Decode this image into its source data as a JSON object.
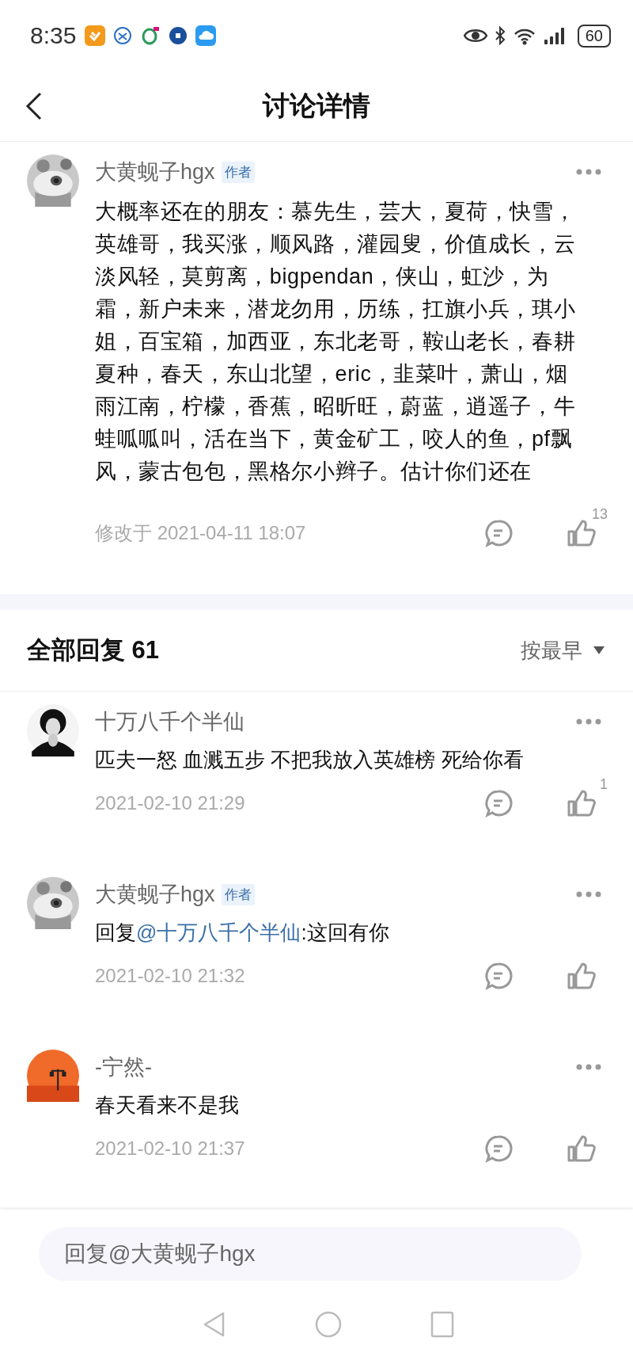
{
  "status_bar": {
    "time": "8:35",
    "battery": "60"
  },
  "header": {
    "title": "讨论详情"
  },
  "post": {
    "author": "大黄蚬子hgx",
    "badge": "作者",
    "body": "大概率还在的朋友：慕先生，芸大，夏荷，快雪，英雄哥，我买涨，顺风路，灌园叟，价值成长，云淡风轻，莫剪离，bigpendan，侠山，虹沙，为霜，新户未来，潜龙勿用，历练，扛旗小兵，琪小姐，百宝箱，加西亚，东北老哥，鞍山老长，春耕夏种，春天，东山北望，eric，韭菜叶，萧山，烟雨江南，柠檬，香蕉，昭昕旺，蔚蓝，逍遥子，牛蛙呱呱叫，活在当下，黄金矿工，咬人的鱼，pf飘风，蒙古包包，黑格尔小辫子。估计你们还在",
    "time": "修改于 2021-04-11 18:07",
    "likes": "13"
  },
  "replies_header": {
    "title": "全部回复 61",
    "sort": "按最早"
  },
  "replies": [
    {
      "author": "十万八千个半仙",
      "segments": [
        {
          "kind": "plain",
          "text": "匹夫一怒 血溅五步 不把我放入英雄榜 死给你看"
        }
      ],
      "time": "2021-02-10 21:29",
      "likes": "1"
    },
    {
      "author": "大黄蚬子hgx",
      "badge": "作者",
      "segments": [
        {
          "kind": "plain",
          "text": "回复"
        },
        {
          "kind": "mention",
          "text": "@十万八千个半仙"
        },
        {
          "kind": "plain",
          "text": ":这回有你"
        }
      ],
      "time": "2021-02-10 21:32"
    },
    {
      "author": "-宁然-",
      "segments": [
        {
          "kind": "plain",
          "text": "春天看来不是我"
        }
      ],
      "time": "2021-02-10 21:37"
    }
  ],
  "reply_box": {
    "placeholder": "回复@大黄蚬子hgx"
  }
}
